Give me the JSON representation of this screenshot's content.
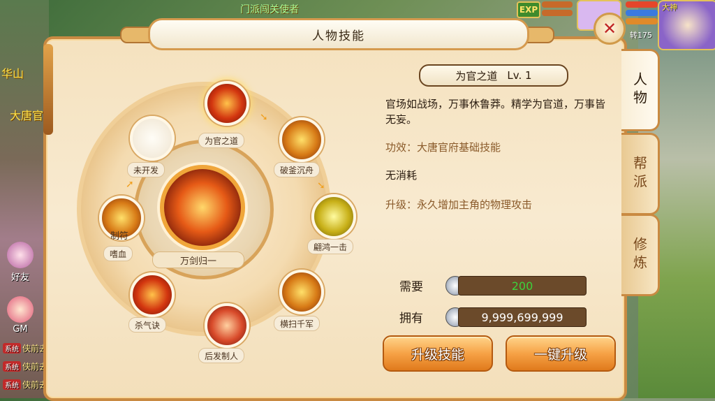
{
  "background": {
    "map_labels": [
      "华山",
      "大唐官"
    ],
    "npc_label": "门派闯关使者",
    "exp_label": "EXP",
    "rebirth_text": "转175",
    "name_short": "大神",
    "left_buttons": [
      "好友",
      "GM"
    ],
    "chat_lines": [
      {
        "tag": "系统",
        "text": "侠前去挑战"
      },
      {
        "tag": "系统",
        "text": "侠前去挑战"
      },
      {
        "tag": "系统",
        "text": "侠前去挑战"
      }
    ]
  },
  "panel": {
    "title": "人物技能",
    "close_label": "✕",
    "center_skill": "万剑归一",
    "skills": [
      {
        "label": "为官之道",
        "icon": "official-helmet-icon",
        "selected": true
      },
      {
        "label": "破釜沉舟",
        "icon": "sword-slash-icon"
      },
      {
        "label": "翩鸿一击",
        "icon": "golden-strike-icon"
      },
      {
        "label": "横扫千军",
        "icon": "sweep-blade-icon"
      },
      {
        "label": "后发制人",
        "icon": "counter-flame-icon"
      },
      {
        "label": "杀气诀",
        "icon": "killing-aura-icon"
      },
      {
        "label": "嗜血",
        "icon": "bloodthirst-icon",
        "sub": "制符"
      },
      {
        "label": "未开发",
        "icon": "locked-slot-icon",
        "locked": true
      }
    ],
    "detail": {
      "name": "为官之道",
      "level": "Lv. 1",
      "description": "官场如战场，万事休鲁莽。精学为官道，万事皆无妄。",
      "effect": "功效：大唐官府基础技能",
      "cost": "无消耗",
      "upgrade": "升级：永久增加主角的物理攻击"
    },
    "requirement": {
      "label": "需要",
      "value": "200"
    },
    "owned": {
      "label": "拥有",
      "value": "9,999,699,999"
    },
    "buttons": {
      "upgrade": "升级技能",
      "one_click": "一键升级"
    },
    "tabs": [
      {
        "label": "人物",
        "active": true
      },
      {
        "label": "帮派"
      },
      {
        "label": "修炼"
      }
    ]
  },
  "colors": {
    "frame": "#c98a42",
    "button": "#f6a246",
    "require_value": "#3cd23c",
    "owned_value": "#ffffff"
  }
}
